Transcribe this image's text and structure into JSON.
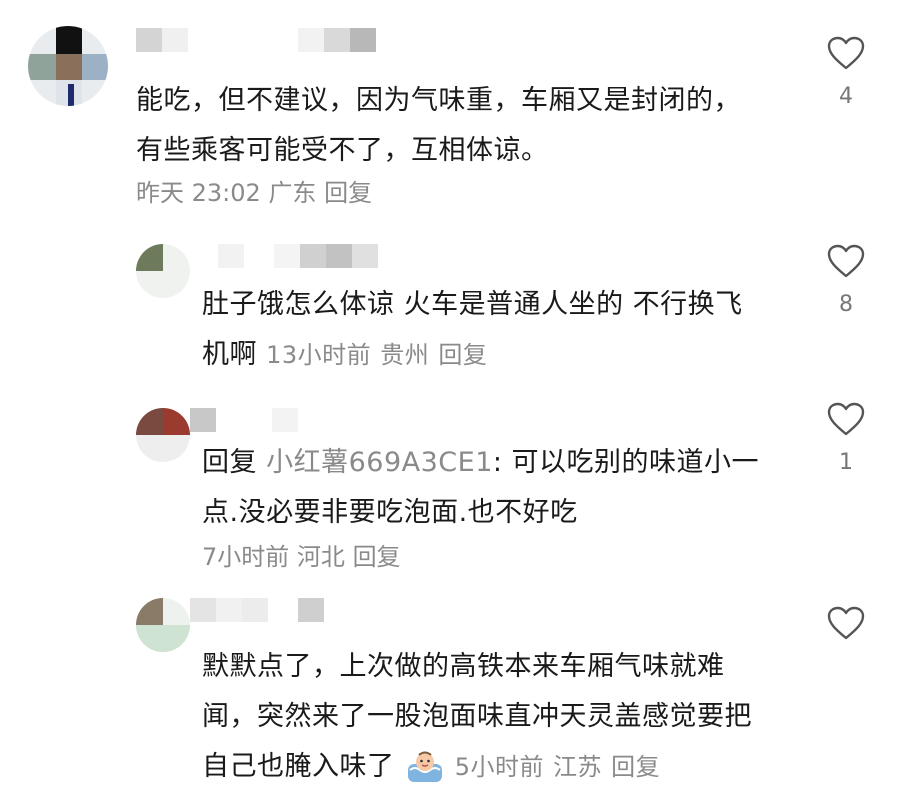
{
  "comments": [
    {
      "text_lines": [
        "能吃，但不建议，因为气味重，车厢又是封闭的，",
        "有些乘客可能受不了，互相体谅。"
      ],
      "time": "昨天 23:02",
      "location": "广东",
      "reply_label": "回复",
      "likes": "4"
    },
    {
      "text_lines": [
        "肚子饿怎么体谅 火车是普通人坐的 不行换飞",
        "机啊"
      ],
      "time": "13小时前",
      "location": "贵州",
      "reply_label": "回复",
      "likes": "8"
    },
    {
      "reply_prefix": "回复",
      "reply_to_user": "小红薯669A3CE1",
      "text_after_user": ": 可以吃别的味道小一",
      "text_line2": "点.没必要非要吃泡面.也不好吃",
      "time": "7小时前",
      "location": "河北",
      "reply_label": "回复",
      "likes": "1"
    },
    {
      "text_lines": [
        "默默点了，上次做的高铁本来车厢气味就难",
        "闻，突然来了一股泡面味直冲天灵盖感觉要把",
        "自己也腌入味了"
      ],
      "emoji": "emoji-sticker",
      "time": "5小时前",
      "location": "江苏",
      "reply_label": "回复",
      "likes": ""
    }
  ],
  "colors": {
    "text": "#1a1a1a",
    "meta": "#8a8a8a",
    "heart_outline": "#555555"
  }
}
